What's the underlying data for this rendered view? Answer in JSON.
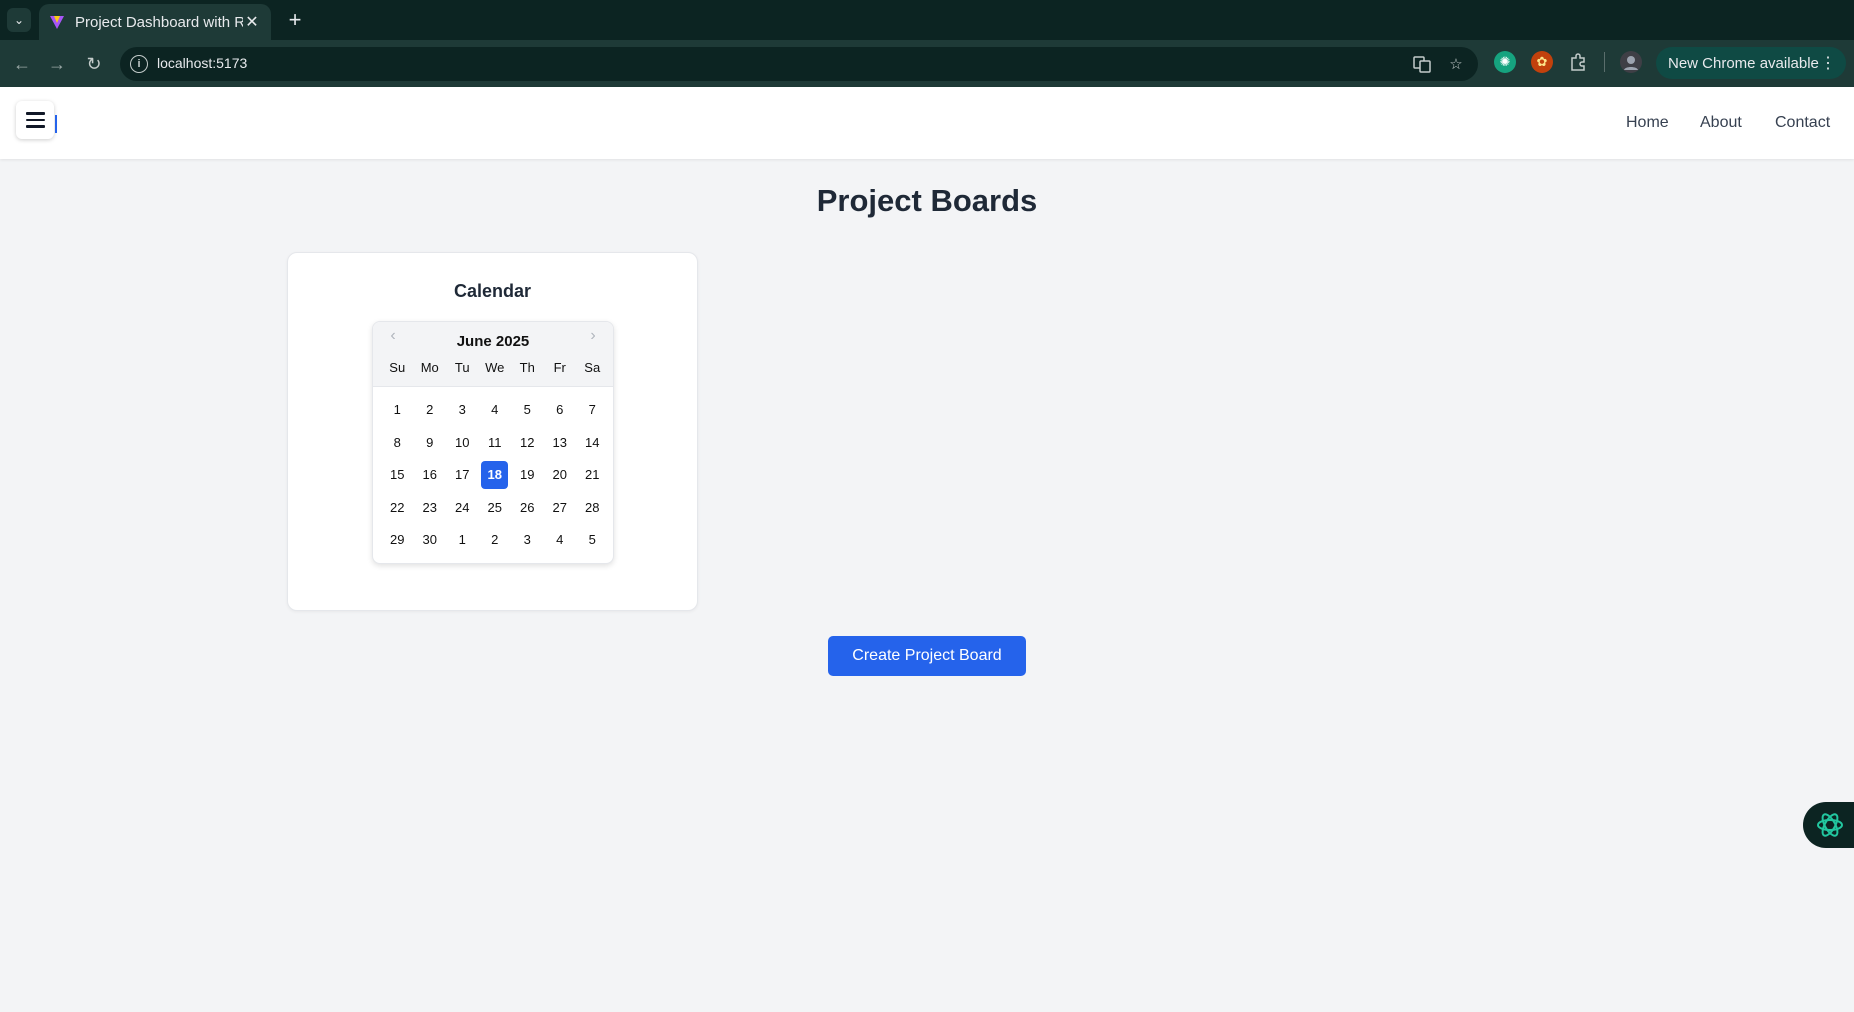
{
  "browser": {
    "tab_title": "Project Dashboard with R",
    "tab_close": "✕",
    "new_tab": "+",
    "url": "localhost:5173",
    "update_label": "New Chrome available",
    "icons": [
      "tab-search-icon",
      "back-icon",
      "forward-icon",
      "reload-icon",
      "info-icon",
      "translate-icon",
      "star-icon",
      "extension-icons",
      "puzzle-icon",
      "profile-icon",
      "more-icon"
    ]
  },
  "nav": {
    "links": [
      "Home",
      "About",
      "Contact"
    ]
  },
  "main": {
    "title": "Project Boards",
    "card_title": "Calendar",
    "create_button": "Create Project Board"
  },
  "calendar": {
    "month_label": "June 2025",
    "weekdays": [
      "Su",
      "Mo",
      "Tu",
      "We",
      "Th",
      "Fr",
      "Sa"
    ],
    "days": [
      "1",
      "2",
      "3",
      "4",
      "5",
      "6",
      "7",
      "8",
      "9",
      "10",
      "11",
      "12",
      "13",
      "14",
      "15",
      "16",
      "17",
      "18",
      "19",
      "20",
      "21",
      "22",
      "23",
      "24",
      "25",
      "26",
      "27",
      "28",
      "29",
      "30",
      "1",
      "2",
      "3",
      "4",
      "5"
    ],
    "selected_day": "18"
  },
  "colors": {
    "accent": "#2563eb",
    "chrome_dark": "#0c2422",
    "chrome_toolbar": "#1e3a37",
    "page_bg": "#f3f4f6"
  }
}
